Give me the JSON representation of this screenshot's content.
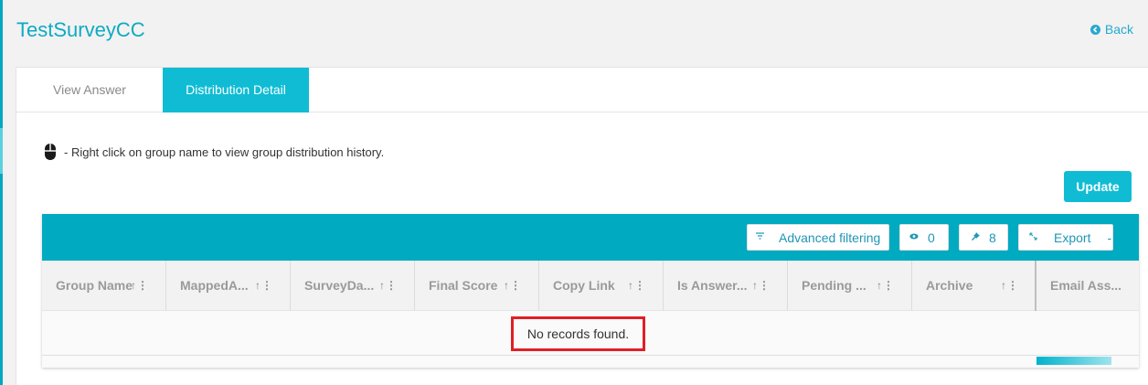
{
  "page": {
    "title": "TestSurveyCC",
    "back_label": "Back",
    "accent_color": "#0fbcd4"
  },
  "tabs": [
    {
      "label": "View Answer",
      "active": false
    },
    {
      "label": "Distribution Detail",
      "active": true
    }
  ],
  "hint": {
    "icon": "mouse-icon",
    "text": "- Right click on group name to view group distribution history."
  },
  "update_label": "Update",
  "toolbar": {
    "filter_label": "Advanced filtering",
    "eye_count": "0",
    "pin_count": "8",
    "export_label": "Export",
    "export_caret": "-"
  },
  "columns": [
    {
      "label": "Group Name"
    },
    {
      "label": "MappedA..."
    },
    {
      "label": "SurveyDa..."
    },
    {
      "label": "Final Score"
    },
    {
      "label": "Copy Link"
    },
    {
      "label": "Is Answer..."
    },
    {
      "label": "Pending ..."
    },
    {
      "label": "Archive"
    },
    {
      "label": "Email Ass..."
    }
  ],
  "empty_message": "No records found."
}
